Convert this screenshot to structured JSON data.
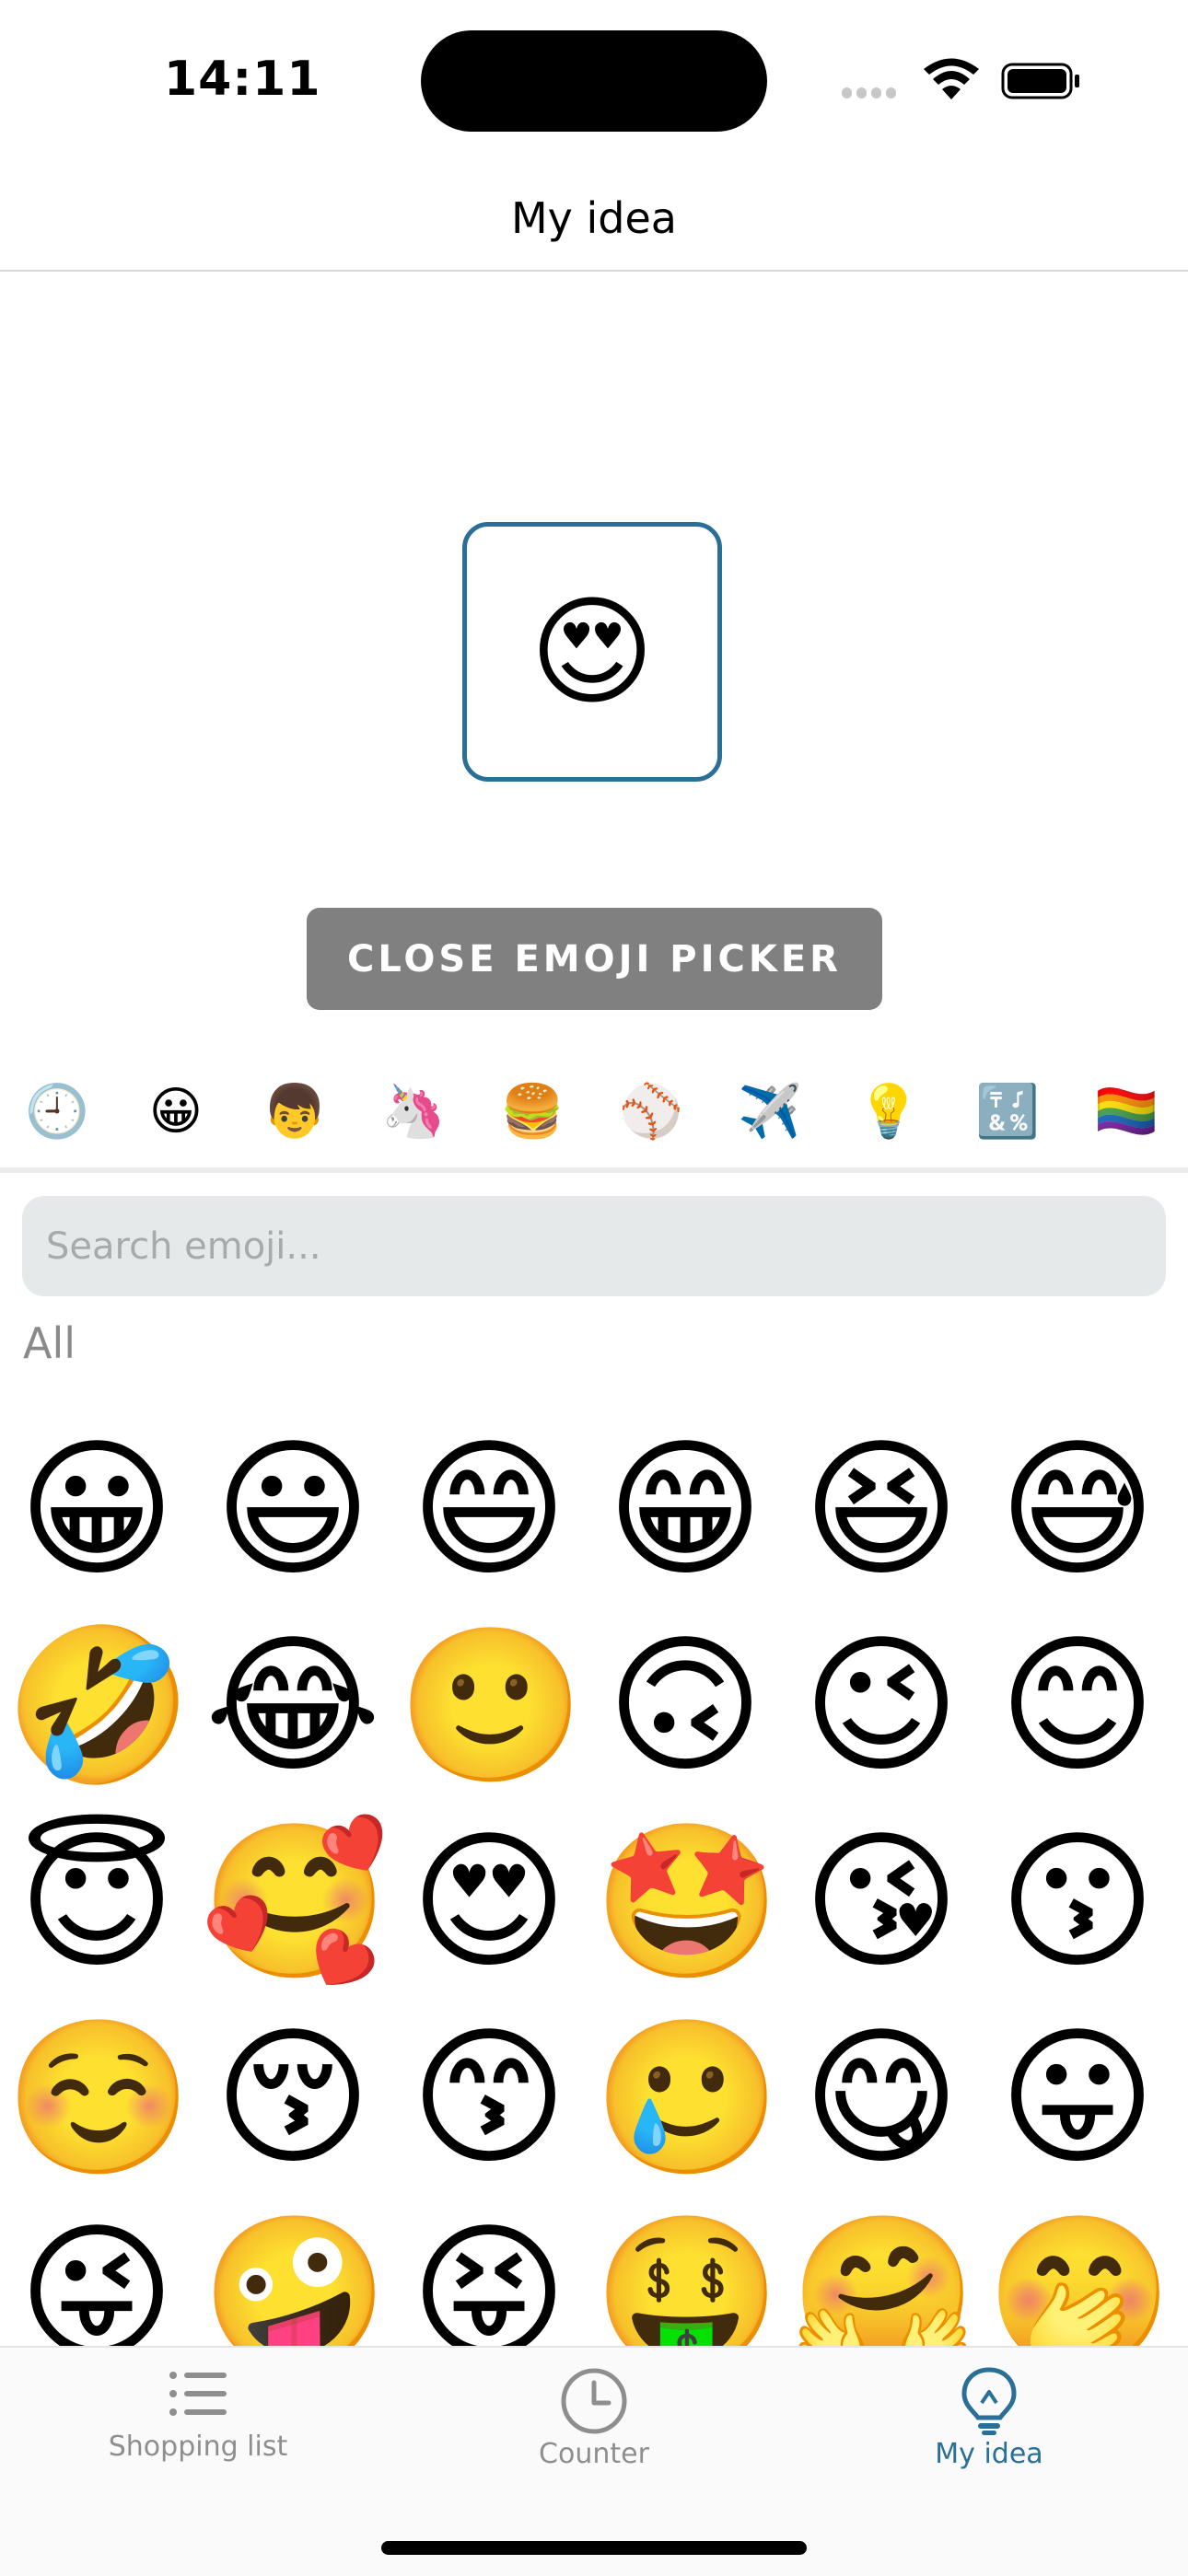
{
  "status": {
    "time": "14:11"
  },
  "header": {
    "title": "My idea"
  },
  "selected_emoji": "😍",
  "close_button_label": "CLOSE EMOJI PICKER",
  "categories": [
    "🕘",
    "😀",
    "👦",
    "🦄",
    "🍔",
    "⚾",
    "✈️",
    "💡",
    "🔣",
    "🏳️‍🌈"
  ],
  "search": {
    "placeholder": "Search emoji..."
  },
  "section_label": "All",
  "emojis": [
    "😀",
    "😃",
    "😄",
    "😁",
    "😆",
    "😅",
    "🤣",
    "😂",
    "🙂",
    "🙃",
    "😉",
    "😊",
    "😇",
    "🥰",
    "😍",
    "🤩",
    "😘",
    "😗",
    "☺️",
    "😚",
    "😙",
    "🥲",
    "😋",
    "😛",
    "😜",
    "🤪",
    "😝",
    "🤑",
    "🤗",
    "🤭"
  ],
  "tabs": [
    {
      "label": "Shopping list",
      "icon": "list-icon",
      "active": false
    },
    {
      "label": "Counter",
      "icon": "clock-icon",
      "active": false
    },
    {
      "label": "My idea",
      "icon": "lightbulb-icon",
      "active": true
    }
  ],
  "colors": {
    "accent": "#2a6f97",
    "inactive": "#8e8e8e",
    "button": "#808080"
  }
}
